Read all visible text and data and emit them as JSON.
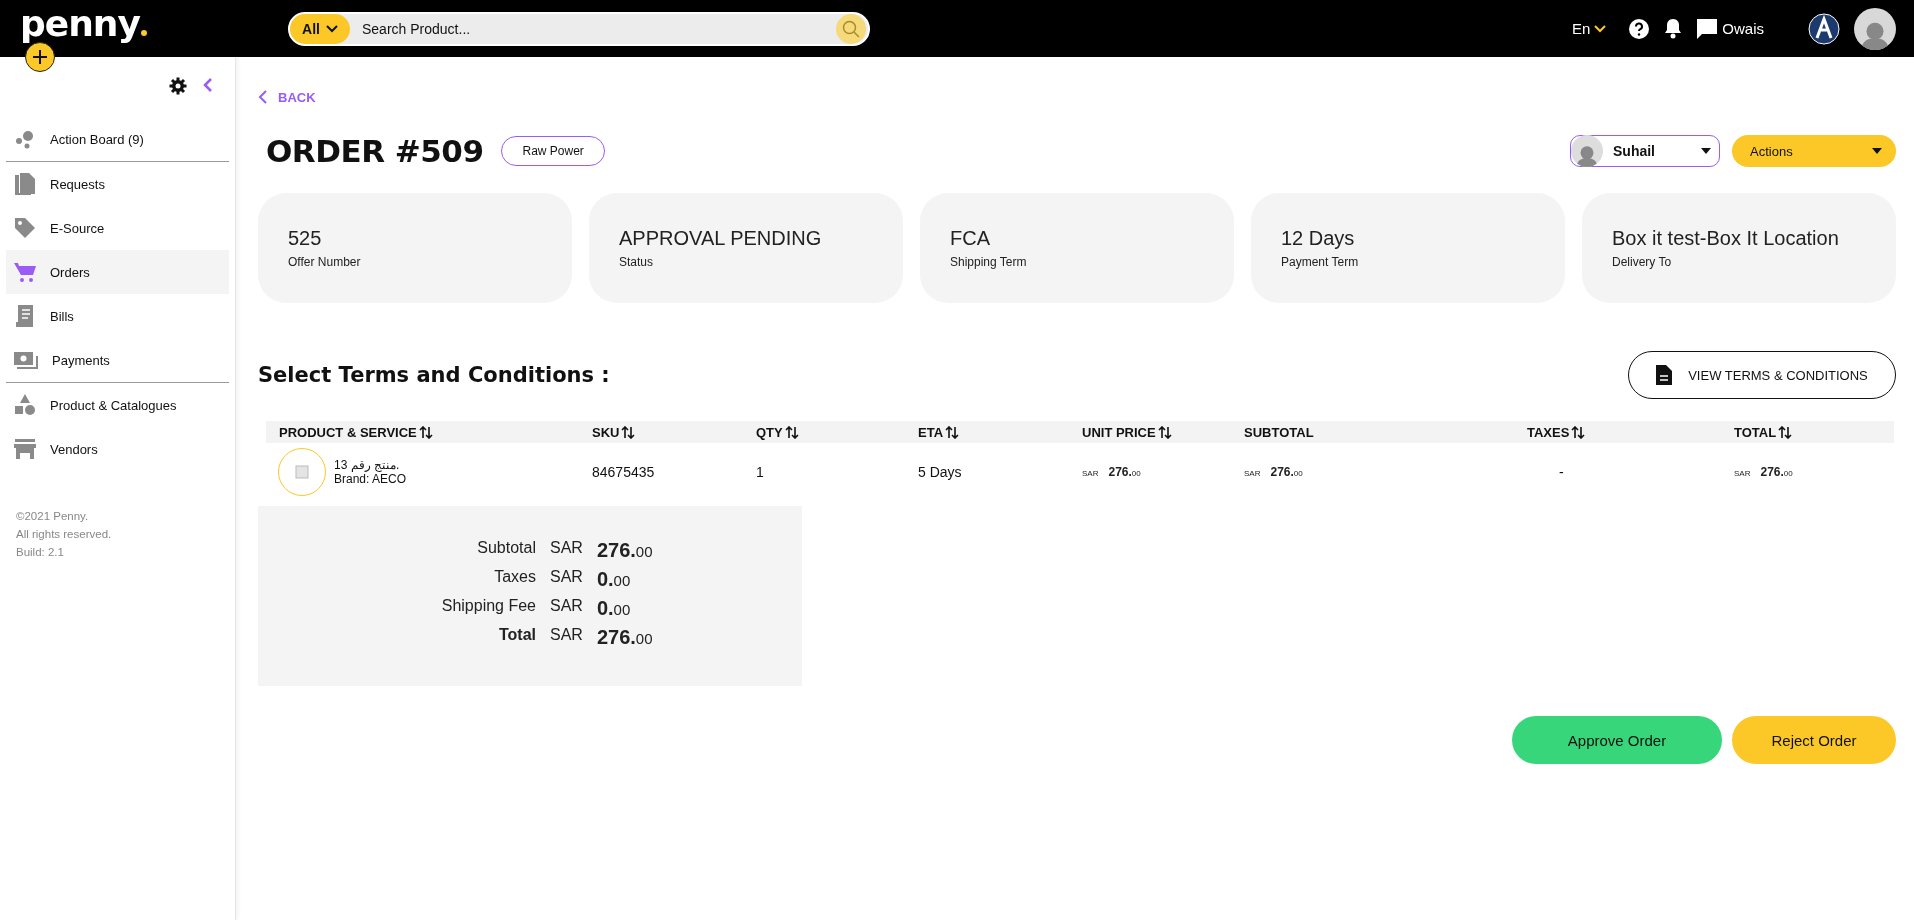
{
  "topbar": {
    "logo": "penny",
    "search": {
      "category": "All",
      "placeholder": "Search Product..."
    },
    "language": "En",
    "user_name": "Owais"
  },
  "sidebar": {
    "sections": [
      [
        {
          "label": "Action Board (9)",
          "selected": false
        }
      ],
      [
        {
          "label": "Requests",
          "selected": false
        },
        {
          "label": "E-Source",
          "selected": false
        },
        {
          "label": "Orders",
          "selected": true
        },
        {
          "label": "Bills",
          "selected": false
        },
        {
          "label": "Payments",
          "selected": false
        }
      ],
      [
        {
          "label": "Product & Catalogues",
          "selected": false
        },
        {
          "label": "Vendors",
          "selected": false
        }
      ]
    ],
    "footer": [
      "©2021 Penny.",
      "All rights reserved.",
      "Build: 2.1"
    ]
  },
  "back": "BACK",
  "title": "ORDER #509",
  "vendor_tag": "Raw Power",
  "assignee": "Suhail",
  "actions": "Actions",
  "cards": [
    {
      "value": "525",
      "label": "Offer Number"
    },
    {
      "value": "APPROVAL PENDING",
      "label": "Status"
    },
    {
      "value": "FCA",
      "label": "Shipping Term"
    },
    {
      "value": "12 Days",
      "label": "Payment Term"
    },
    {
      "value": "Box it test-Box It Location",
      "label": "Delivery To"
    }
  ],
  "terms_heading": "Select Terms and Conditions :",
  "terms_button": "VIEW TERMS & CONDITIONS",
  "table": {
    "columns": [
      {
        "label": "PRODUCT & SERVICE",
        "sortable": true
      },
      {
        "label": "SKU",
        "sortable": true
      },
      {
        "label": "QTY",
        "sortable": true
      },
      {
        "label": "ETA",
        "sortable": true
      },
      {
        "label": "UNIT PRICE",
        "sortable": true
      },
      {
        "label": "SUBTOTAL",
        "sortable": false
      },
      {
        "label": "TAXES",
        "sortable": true
      },
      {
        "label": "TOTAL",
        "sortable": true
      }
    ],
    "rows": [
      {
        "name": "منتج رقم 13.",
        "brand": "Brand: AECO",
        "sku": "84675435",
        "qty": "1",
        "eta": "5 Days",
        "unit_price": {
          "currency": "SAR",
          "whole": "276.",
          "cents": "00"
        },
        "subtotal": {
          "currency": "SAR",
          "whole": "276.",
          "cents": "00"
        },
        "taxes": "-",
        "total": {
          "currency": "SAR",
          "whole": "276.",
          "cents": "00"
        }
      }
    ]
  },
  "summary": [
    {
      "label": "Subtotal",
      "bold": false,
      "currency": "SAR",
      "whole": "276.",
      "cents": "00"
    },
    {
      "label": "Taxes",
      "bold": false,
      "currency": "SAR",
      "whole": "0.",
      "cents": "00"
    },
    {
      "label": "Shipping Fee",
      "bold": false,
      "currency": "SAR",
      "whole": "0.",
      "cents": "00"
    },
    {
      "label": "Total",
      "bold": true,
      "currency": "SAR",
      "whole": "276.",
      "cents": "00"
    }
  ],
  "buttons": [
    {
      "label": "Approve Order",
      "kind": "approve"
    },
    {
      "label": "Reject Order",
      "kind": "reject"
    }
  ]
}
